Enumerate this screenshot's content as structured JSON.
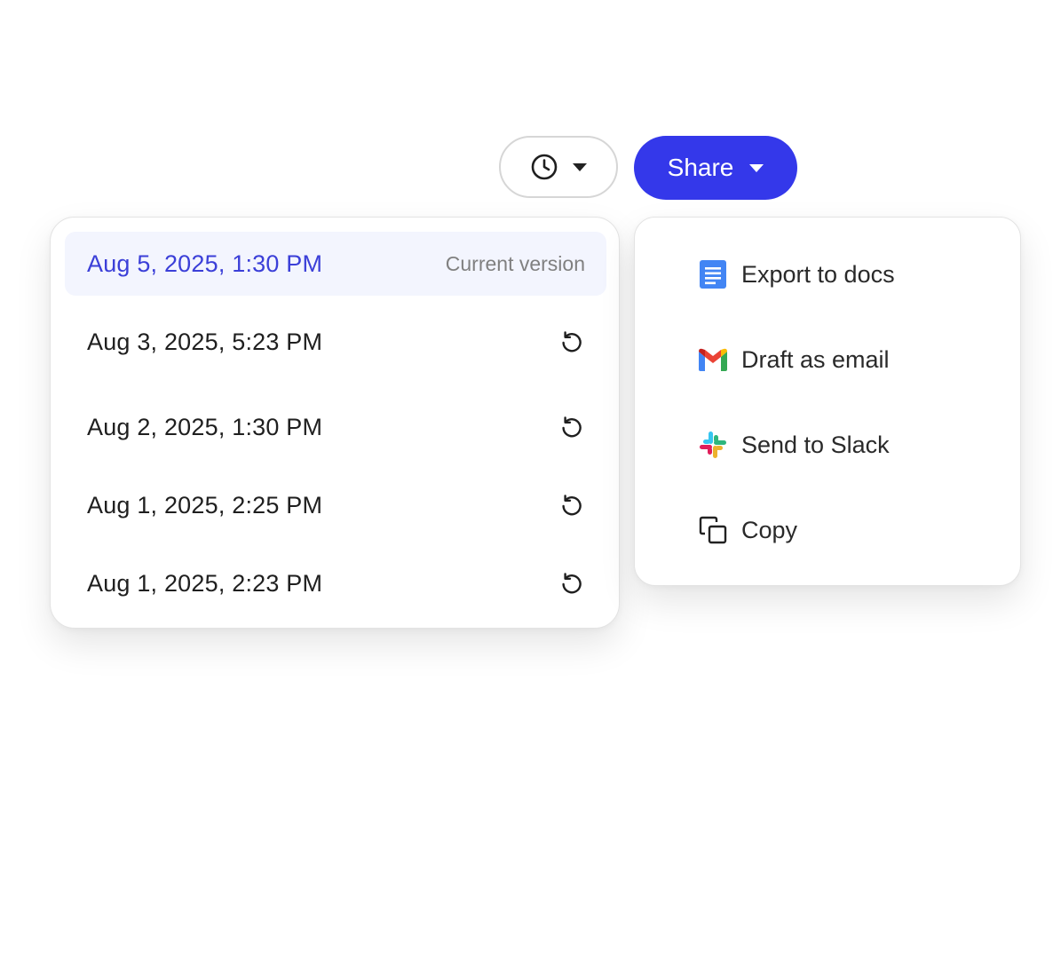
{
  "toolbar": {
    "history_icon": "clock-icon",
    "share_label": "Share",
    "accent_color": "#3438ea"
  },
  "history": {
    "items": [
      {
        "date": "Aug 5, 2025, 1:30 PM",
        "meta": "Current version",
        "current": true
      },
      {
        "date": "Aug 3, 2025, 5:23 PM",
        "icon": "restore-icon"
      },
      {
        "date": "Aug 2, 2025, 1:30 PM",
        "icon": "restore-icon"
      },
      {
        "date": "Aug 1, 2025, 2:25 PM",
        "icon": "restore-icon"
      },
      {
        "date": "Aug 1, 2025, 2:23 PM",
        "icon": "restore-icon"
      }
    ]
  },
  "share_menu": {
    "items": [
      {
        "label": "Export to docs",
        "icon": "google-docs-icon"
      },
      {
        "label": "Draft as email",
        "icon": "gmail-icon"
      },
      {
        "label": "Send to Slack",
        "icon": "slack-icon"
      },
      {
        "label": "Copy",
        "icon": "copy-icon"
      }
    ]
  }
}
